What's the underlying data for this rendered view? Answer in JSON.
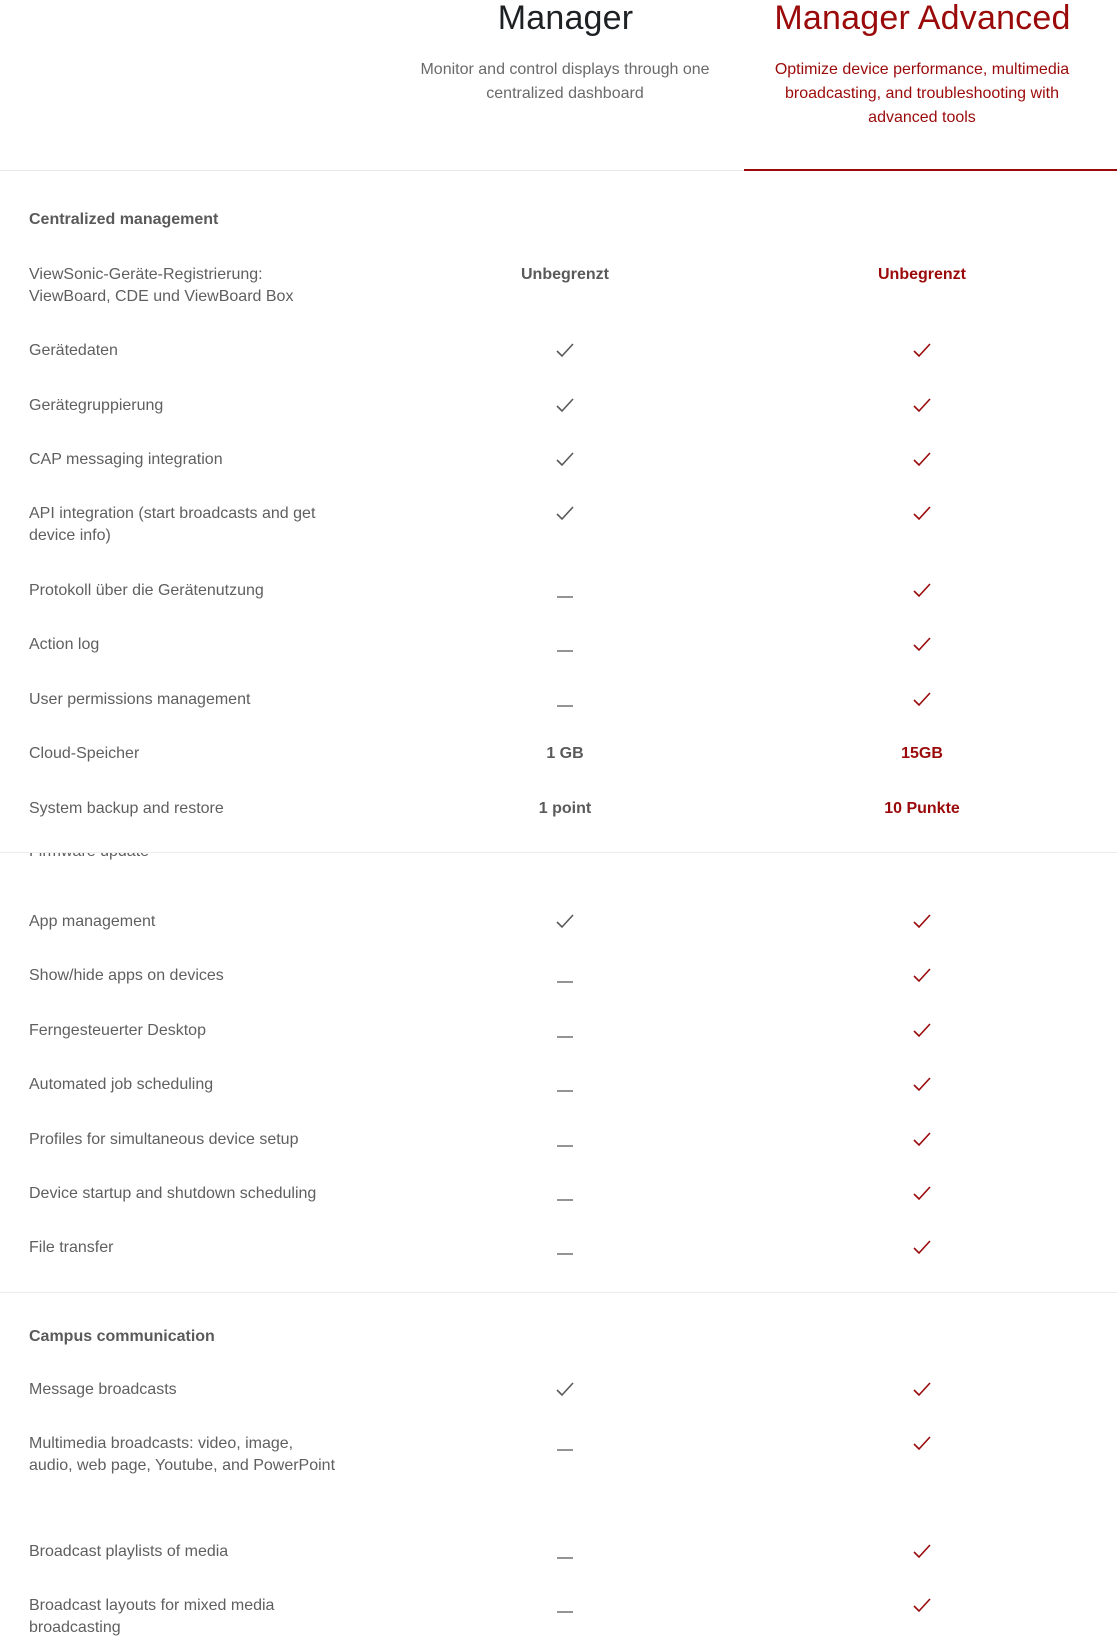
{
  "plans": {
    "manager": {
      "title": "Manager",
      "subtitle": "Monitor and control displays through one centralized dashboard",
      "color": "#5a5a5a"
    },
    "advanced": {
      "title": "Manager Advanced",
      "subtitle": "Optimize device performance, multimedia broadcasting, and troubleshooting with advanced tools",
      "color": "#9b0a0a"
    }
  },
  "icons": {
    "check": "check-icon",
    "dash": "dash-icon"
  },
  "sections": [
    {
      "title": "Centralized management",
      "rows": [
        {
          "label": "ViewSonic-Geräte-Registrierung: ViewBoard, CDE und ViewBoard Box",
          "manager": {
            "type": "text",
            "value": "Unbegrenzt"
          },
          "advanced": {
            "type": "text",
            "value": "Unbegrenzt"
          }
        },
        {
          "label": "Gerätedaten",
          "manager": {
            "type": "check"
          },
          "advanced": {
            "type": "check"
          }
        },
        {
          "label": "Gerätegruppierung",
          "manager": {
            "type": "check"
          },
          "advanced": {
            "type": "check"
          }
        },
        {
          "label": "CAP messaging integration",
          "manager": {
            "type": "check"
          },
          "advanced": {
            "type": "check"
          }
        },
        {
          "label": "API integration (start broadcasts and get device info)",
          "manager": {
            "type": "check"
          },
          "advanced": {
            "type": "check"
          }
        },
        {
          "label": "Protokoll über die Gerätenutzung",
          "manager": {
            "type": "dash"
          },
          "advanced": {
            "type": "check"
          }
        },
        {
          "label": "Action log",
          "manager": {
            "type": "dash"
          },
          "advanced": {
            "type": "check"
          }
        },
        {
          "label": "User permissions management",
          "manager": {
            "type": "dash"
          },
          "advanced": {
            "type": "check"
          }
        },
        {
          "label": "Cloud-Speicher",
          "manager": {
            "type": "text",
            "value": "1 GB"
          },
          "advanced": {
            "type": "text",
            "value": "15GB"
          }
        },
        {
          "label": "System backup and restore",
          "manager": {
            "type": "text",
            "value": "1 point"
          },
          "advanced": {
            "type": "text",
            "value": "10 Punkte"
          }
        }
      ]
    },
    {
      "title": "",
      "clipped_label": "Firmware update",
      "rows": [
        {
          "label": "App management",
          "manager": {
            "type": "check"
          },
          "advanced": {
            "type": "check"
          }
        },
        {
          "label": "Show/hide apps on devices",
          "manager": {
            "type": "dash"
          },
          "advanced": {
            "type": "check"
          }
        },
        {
          "label": "Ferngesteuerter Desktop",
          "manager": {
            "type": "dash"
          },
          "advanced": {
            "type": "check"
          }
        },
        {
          "label": "Automated job scheduling",
          "manager": {
            "type": "dash"
          },
          "advanced": {
            "type": "check"
          }
        },
        {
          "label": "Profiles for simultaneous device setup",
          "manager": {
            "type": "dash"
          },
          "advanced": {
            "type": "check"
          }
        },
        {
          "label": "Device startup and shutdown scheduling",
          "manager": {
            "type": "dash"
          },
          "advanced": {
            "type": "check"
          }
        },
        {
          "label": "File transfer",
          "manager": {
            "type": "dash"
          },
          "advanced": {
            "type": "check"
          }
        }
      ]
    },
    {
      "title": "Campus communication",
      "rows": [
        {
          "label": "Message broadcasts",
          "manager": {
            "type": "check"
          },
          "advanced": {
            "type": "check"
          }
        },
        {
          "label": "Multimedia broadcasts: video, image, audio, web page, Youtube, and PowerPoint",
          "manager": {
            "type": "dash"
          },
          "advanced": {
            "type": "check"
          }
        },
        {
          "label": "Broadcast playlists of media",
          "manager": {
            "type": "dash"
          },
          "advanced": {
            "type": "check"
          }
        },
        {
          "label": "Broadcast layouts for mixed media broadcasting",
          "manager": {
            "type": "dash"
          },
          "advanced": {
            "type": "check"
          }
        }
      ]
    }
  ]
}
